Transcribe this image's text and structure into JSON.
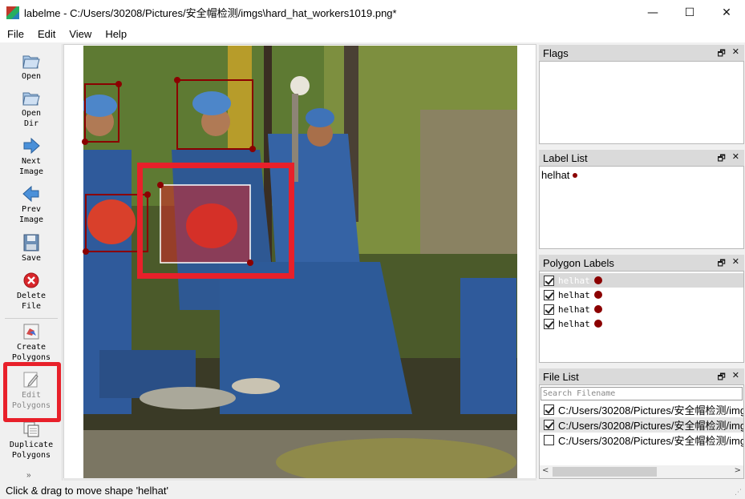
{
  "window": {
    "title": "labelme - C:/Users/30208/Pictures/安全帽检测/imgs\\hard_hat_workers1019.png*",
    "minimize": "—",
    "maximize": "☐",
    "close": "✕"
  },
  "menu": [
    "File",
    "Edit",
    "View",
    "Help"
  ],
  "toolbar": {
    "open": "Open",
    "open_dir_1": "Open",
    "open_dir_2": "Dir",
    "next_1": "Next",
    "next_2": "Image",
    "prev_1": "Prev",
    "prev_2": "Image",
    "save": "Save",
    "delete_1": "Delete",
    "delete_2": "File",
    "create_1": "Create",
    "create_2": "Polygons",
    "edit_1": "Edit",
    "edit_2": "Polygons",
    "duplicate_1": "Duplicate",
    "duplicate_2": "Polygons",
    "more": "»"
  },
  "docks": {
    "flags": {
      "title": "Flags"
    },
    "label_list": {
      "title": "Label List",
      "items": [
        {
          "label": "helhat",
          "color": "#8b0000"
        }
      ]
    },
    "polygon_labels": {
      "title": "Polygon Labels",
      "items": [
        {
          "label": "helhat",
          "checked": true,
          "selected": true,
          "color": "#8b0000"
        },
        {
          "label": "helhat",
          "checked": true,
          "selected": false,
          "color": "#8b0000"
        },
        {
          "label": "helhat",
          "checked": true,
          "selected": false,
          "color": "#8b0000"
        },
        {
          "label": "helhat",
          "checked": true,
          "selected": false,
          "color": "#8b0000"
        }
      ]
    },
    "file_list": {
      "title": "File List",
      "search_placeholder": "Search Filename",
      "files": [
        {
          "path": "C:/Users/30208/Pictures/安全帽检测/img",
          "checked": true,
          "selected": false
        },
        {
          "path": "C:/Users/30208/Pictures/安全帽检测/img",
          "checked": true,
          "selected": true
        },
        {
          "path": "C:/Users/30208/Pictures/安全帽检测/img",
          "checked": false,
          "selected": false
        }
      ]
    },
    "dock_float": "🗗",
    "dock_close": "✕"
  },
  "status": {
    "text": "Click & drag to move shape 'helhat'"
  },
  "colors": {
    "shape_outline": "#8b0000",
    "highlight": "#e8202a"
  }
}
